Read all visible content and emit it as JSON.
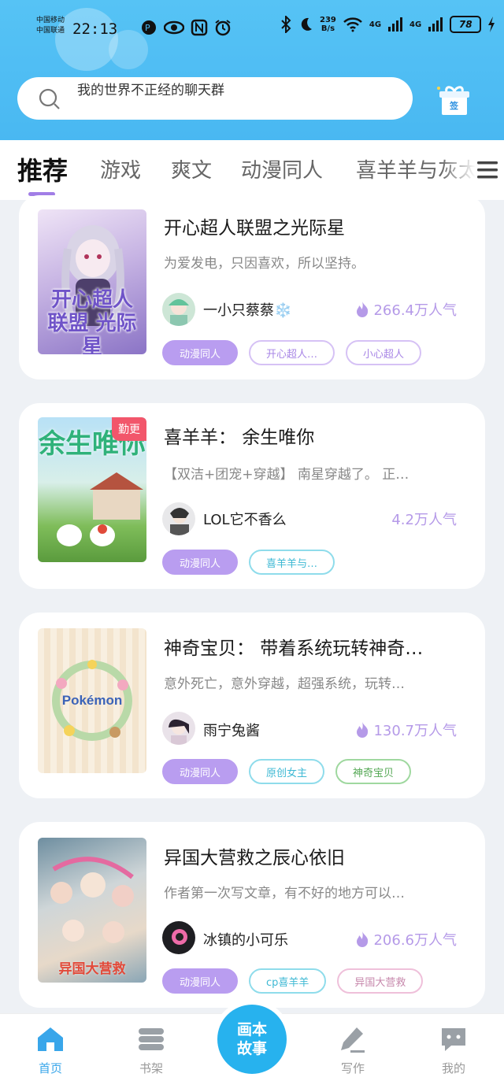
{
  "status_bar": {
    "carrier1": "中国移动",
    "carrier2": "中国联通",
    "time": "22:13",
    "speed_value": "239",
    "speed_unit": "B/s",
    "net1": "4G",
    "net2": "4G",
    "battery": "78"
  },
  "search": {
    "placeholder": "我的世界不正经的聊天群"
  },
  "sign_button": {
    "label": "签"
  },
  "tabs": [
    {
      "label": "推荐"
    },
    {
      "label": "游戏"
    },
    {
      "label": "爽文"
    },
    {
      "label": "动漫同人"
    },
    {
      "label": "喜羊羊与灰太"
    }
  ],
  "cards": [
    {
      "title": "开心超人联盟之光际星",
      "desc": "为爱发电，只因喜欢，所以坚持。",
      "author": "一小只蔡蔡❄️",
      "popularity": "266.4万人气",
      "cover_text": "开心超人 联盟 光际星",
      "tags": [
        "动漫同人",
        "开心超人…",
        "小心超人"
      ]
    },
    {
      "title": "喜羊羊： 余生唯你",
      "desc": "【双洁+团宠+穿越】 南星穿越了。 正…",
      "author": "LOL它不香么",
      "popularity": "4.2万人气",
      "badge": "勤更",
      "cover_text": "余生唯你",
      "tags": [
        "动漫同人",
        "喜羊羊与…"
      ]
    },
    {
      "title": "神奇宝贝： 带着系统玩转神奇…",
      "desc": "意外死亡，意外穿越，超强系统，玩转…",
      "author": "雨宁兔酱",
      "popularity": "130.7万人气",
      "cover_text": "Pokémon",
      "tags": [
        "动漫同人",
        "原创女主",
        "神奇宝贝"
      ]
    },
    {
      "title": "异国大营救之辰心依旧",
      "desc": "作者第一次写文章，有不好的地方可以…",
      "author": "冰镇的小可乐",
      "popularity": "206.6万人气",
      "cover_text": "异国大营救",
      "tags": [
        "动漫同人",
        "cp喜羊羊",
        "异国大营救"
      ]
    }
  ],
  "bottom_nav": {
    "home": "首页",
    "shelf": "书架",
    "center_line1": "画本",
    "center_line2": "故事",
    "write": "写作",
    "mine": "我的"
  },
  "colors": {
    "header": "#4ab9f3",
    "accent": "#a17ee6",
    "nav_active": "#39a6ea",
    "badge": "#f2566b"
  }
}
